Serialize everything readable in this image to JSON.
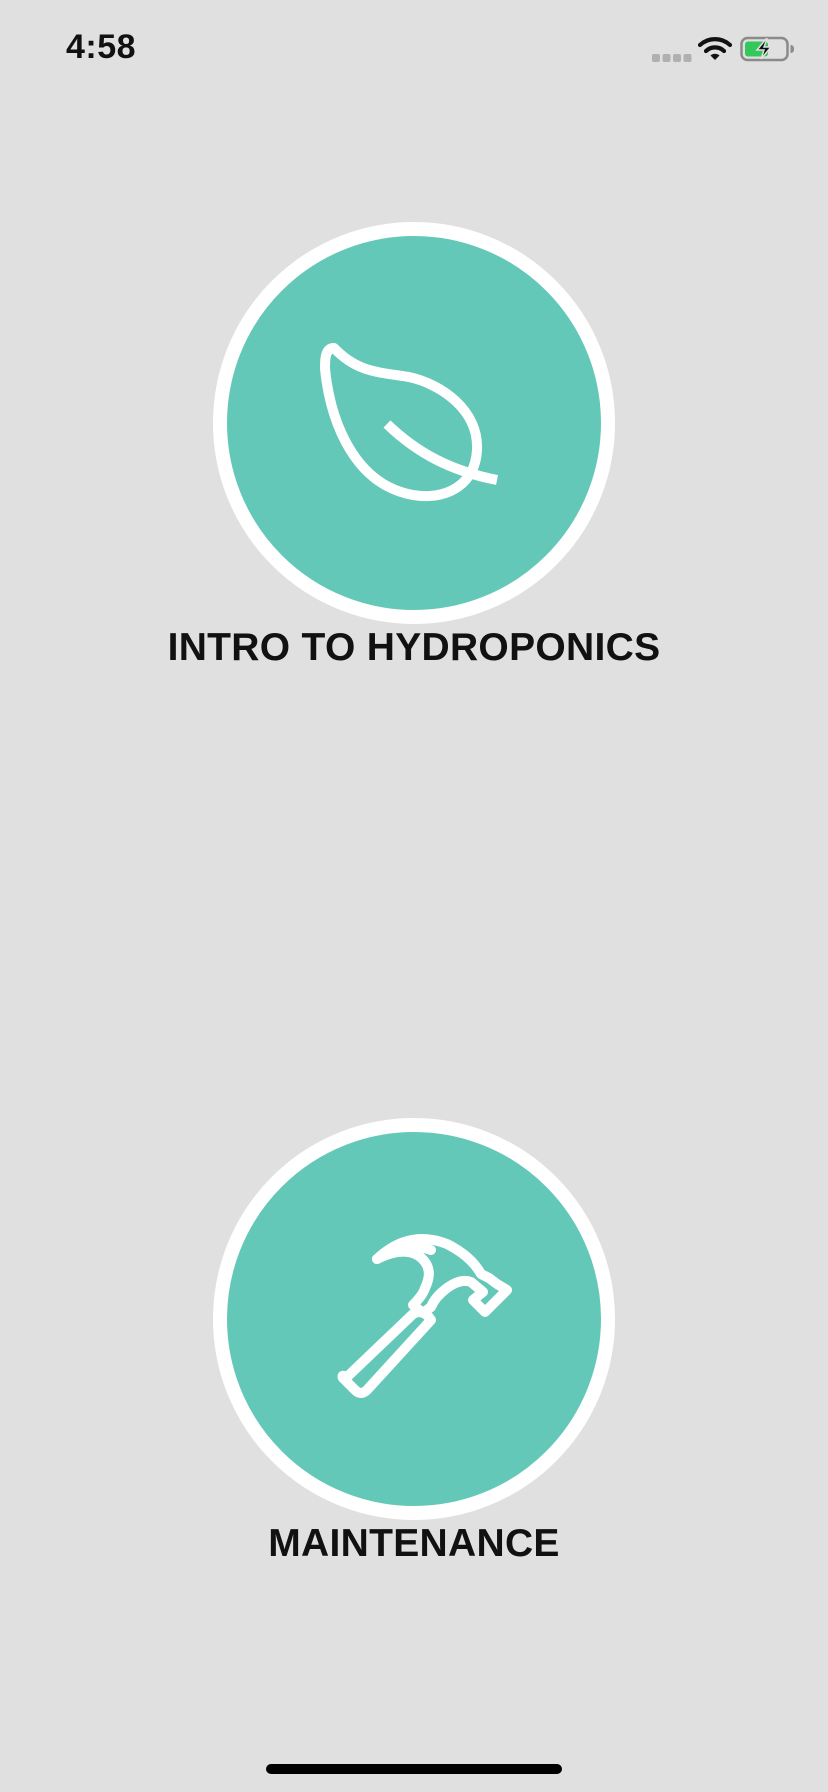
{
  "status_bar": {
    "time": "4:58",
    "icons": [
      "cellular-signal-icon",
      "wifi-icon",
      "battery-charging-icon"
    ],
    "battery_color": "#34c759"
  },
  "menu": {
    "items": [
      {
        "label": "INTRO TO HYDROPONICS",
        "icon": "leaf-icon"
      },
      {
        "label": "MAINTENANCE",
        "icon": "hammer-icon"
      }
    ],
    "accent_color": "#64c8b8",
    "ring_color": "#ffffff"
  },
  "colors": {
    "background": "#e0e0e0",
    "text": "#111111"
  }
}
